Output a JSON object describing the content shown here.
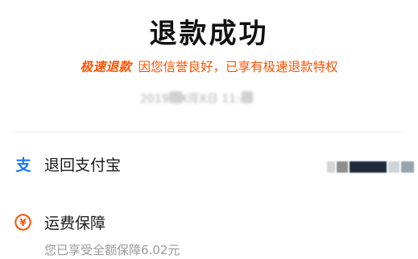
{
  "header": {
    "title": "退款成功",
    "badge": "极速退款",
    "notice": "因您信誉良好，已享有极速退款特权",
    "timestamp": "2019年X月X日 11:43"
  },
  "refund": {
    "method_label": "退回支付宝",
    "method_icon": "alipay-icon"
  },
  "freight": {
    "label": "运费保障",
    "icon": "freight-insurance-icon",
    "sub_text": "您已享受全额保障6.02元"
  },
  "colors": {
    "accent": "#ff5000",
    "alipay_blue": "#1677ff",
    "title": "#111111",
    "secondary_text": "#999999"
  }
}
